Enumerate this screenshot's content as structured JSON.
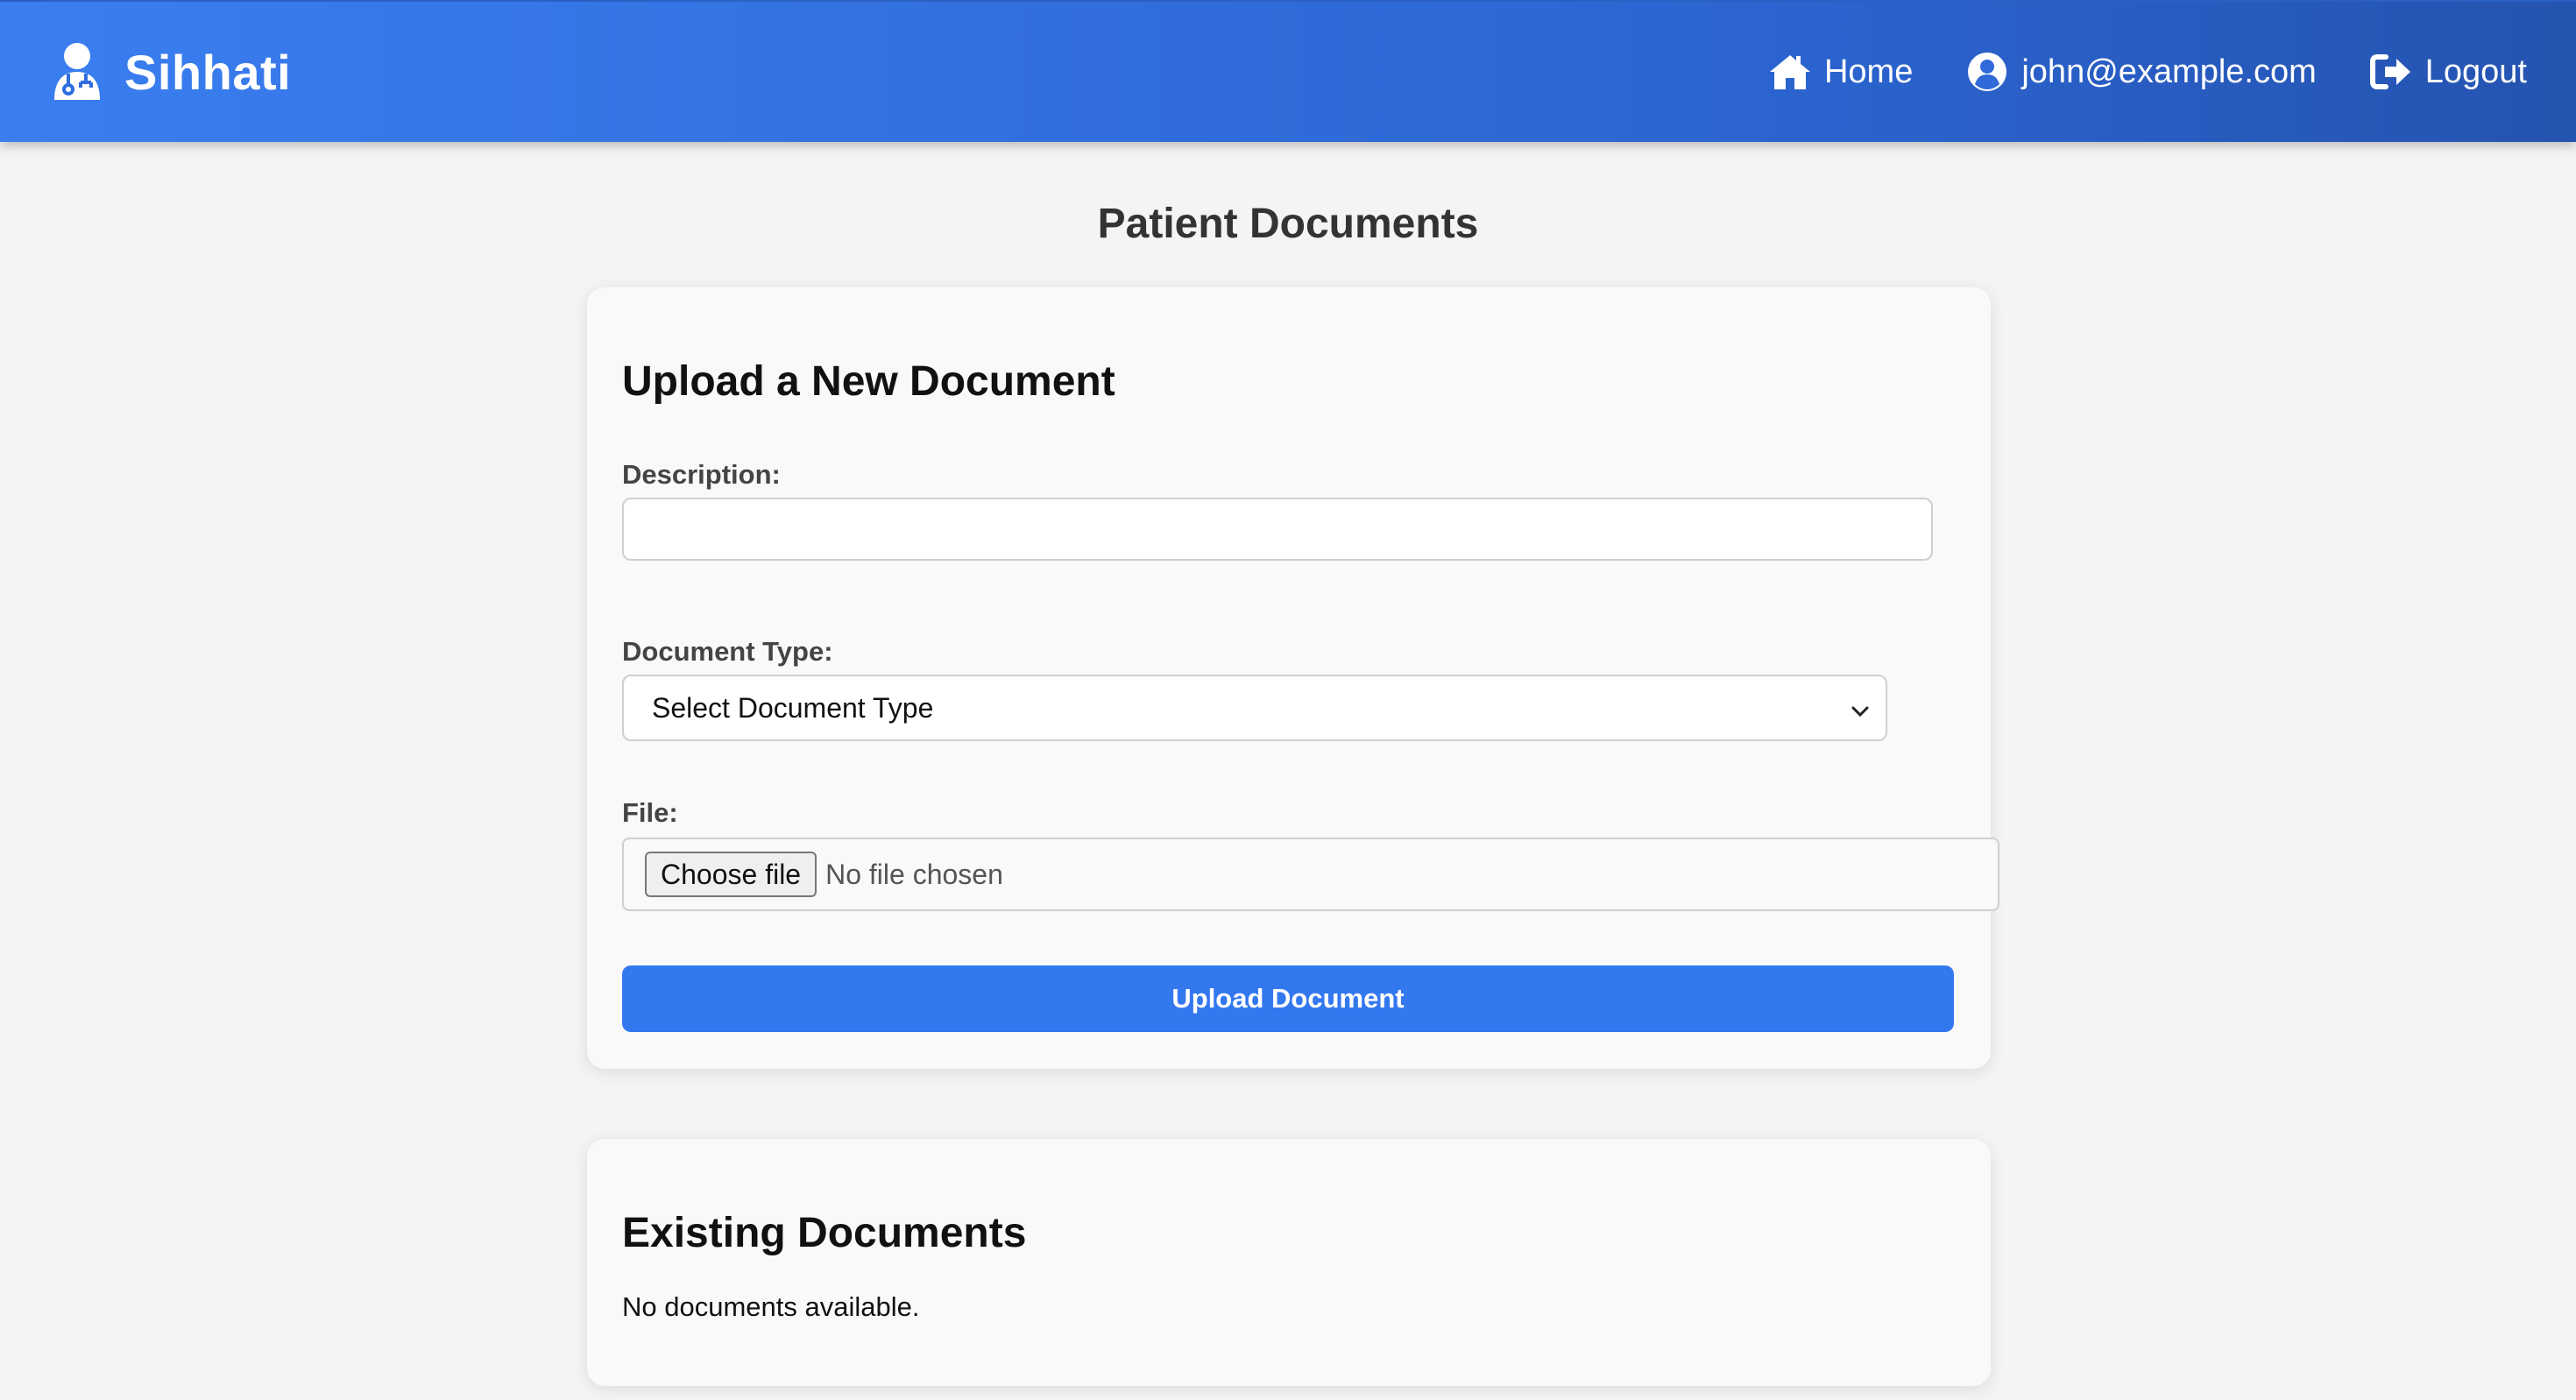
{
  "navbar": {
    "brand": "Sihhati",
    "links": {
      "home": "Home",
      "user": "john@example.com",
      "logout": "Logout"
    },
    "colors": {
      "gradient_start": "#3a7ef0",
      "gradient_end": "#2553b0"
    }
  },
  "page": {
    "title": "Patient Documents"
  },
  "upload_form": {
    "heading": "Upload a New Document",
    "description_label": "Description:",
    "description_value": "",
    "document_type_label": "Document Type:",
    "document_type_selected": "Select Document Type",
    "file_label": "File:",
    "choose_file_label": "Choose file",
    "file_status": "No file chosen",
    "submit_label": "Upload Document",
    "submit_color": "#3478f0"
  },
  "existing_documents": {
    "heading": "Existing Documents",
    "empty_message": "No documents available.",
    "items": []
  },
  "icons": {
    "brand": "doctor-icon",
    "home": "home-icon",
    "user": "user-circle-icon",
    "logout": "logout-icon",
    "select": "chevron-down-icon"
  }
}
